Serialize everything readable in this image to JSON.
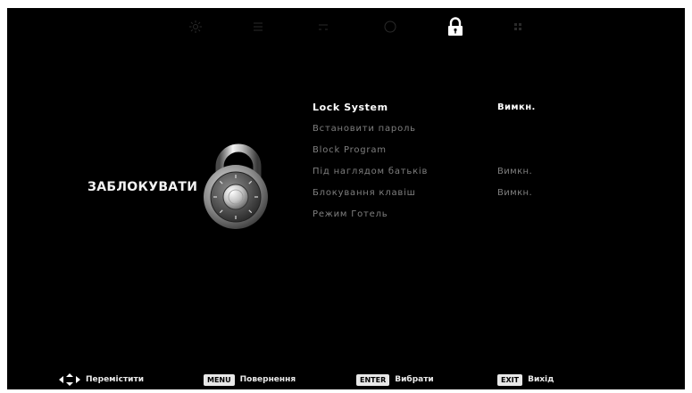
{
  "tabs": [
    {
      "icon": "picture-icon",
      "active": false
    },
    {
      "icon": "sound-icon",
      "active": false
    },
    {
      "icon": "channel-icon",
      "active": false
    },
    {
      "icon": "time-icon",
      "active": false
    },
    {
      "icon": "lock-icon",
      "active": true
    },
    {
      "icon": "setup-icon",
      "active": false
    }
  ],
  "section": {
    "title": "ЗАБЛОКУВАТИ",
    "illustration_icon": "combination-padlock-icon"
  },
  "menu": {
    "selected_index": 0,
    "items": [
      {
        "label": "Lock System",
        "value": "Вимкн."
      },
      {
        "label": "Встановити пароль",
        "value": ""
      },
      {
        "label": "Block Program",
        "value": ""
      },
      {
        "label": "Під наглядом батьків",
        "value": "Вимкн."
      },
      {
        "label": "Блокування клавіш",
        "value": "Вимкн."
      },
      {
        "label": "Режим Готель",
        "value": ""
      }
    ]
  },
  "footer": {
    "move": {
      "icon": "directional-arrows-icon",
      "label": "Перемістити"
    },
    "back": {
      "key": "MENU",
      "label": "Повернення"
    },
    "select": {
      "key": "ENTER",
      "label": "Вибрати"
    },
    "exit": {
      "key": "EXIT",
      "label": "Вихід"
    }
  },
  "colors": {
    "background": "#000000",
    "selected_text": "#ffffff",
    "inactive_text": "#7f7f7f",
    "key_badge": "#e8e8e8"
  }
}
